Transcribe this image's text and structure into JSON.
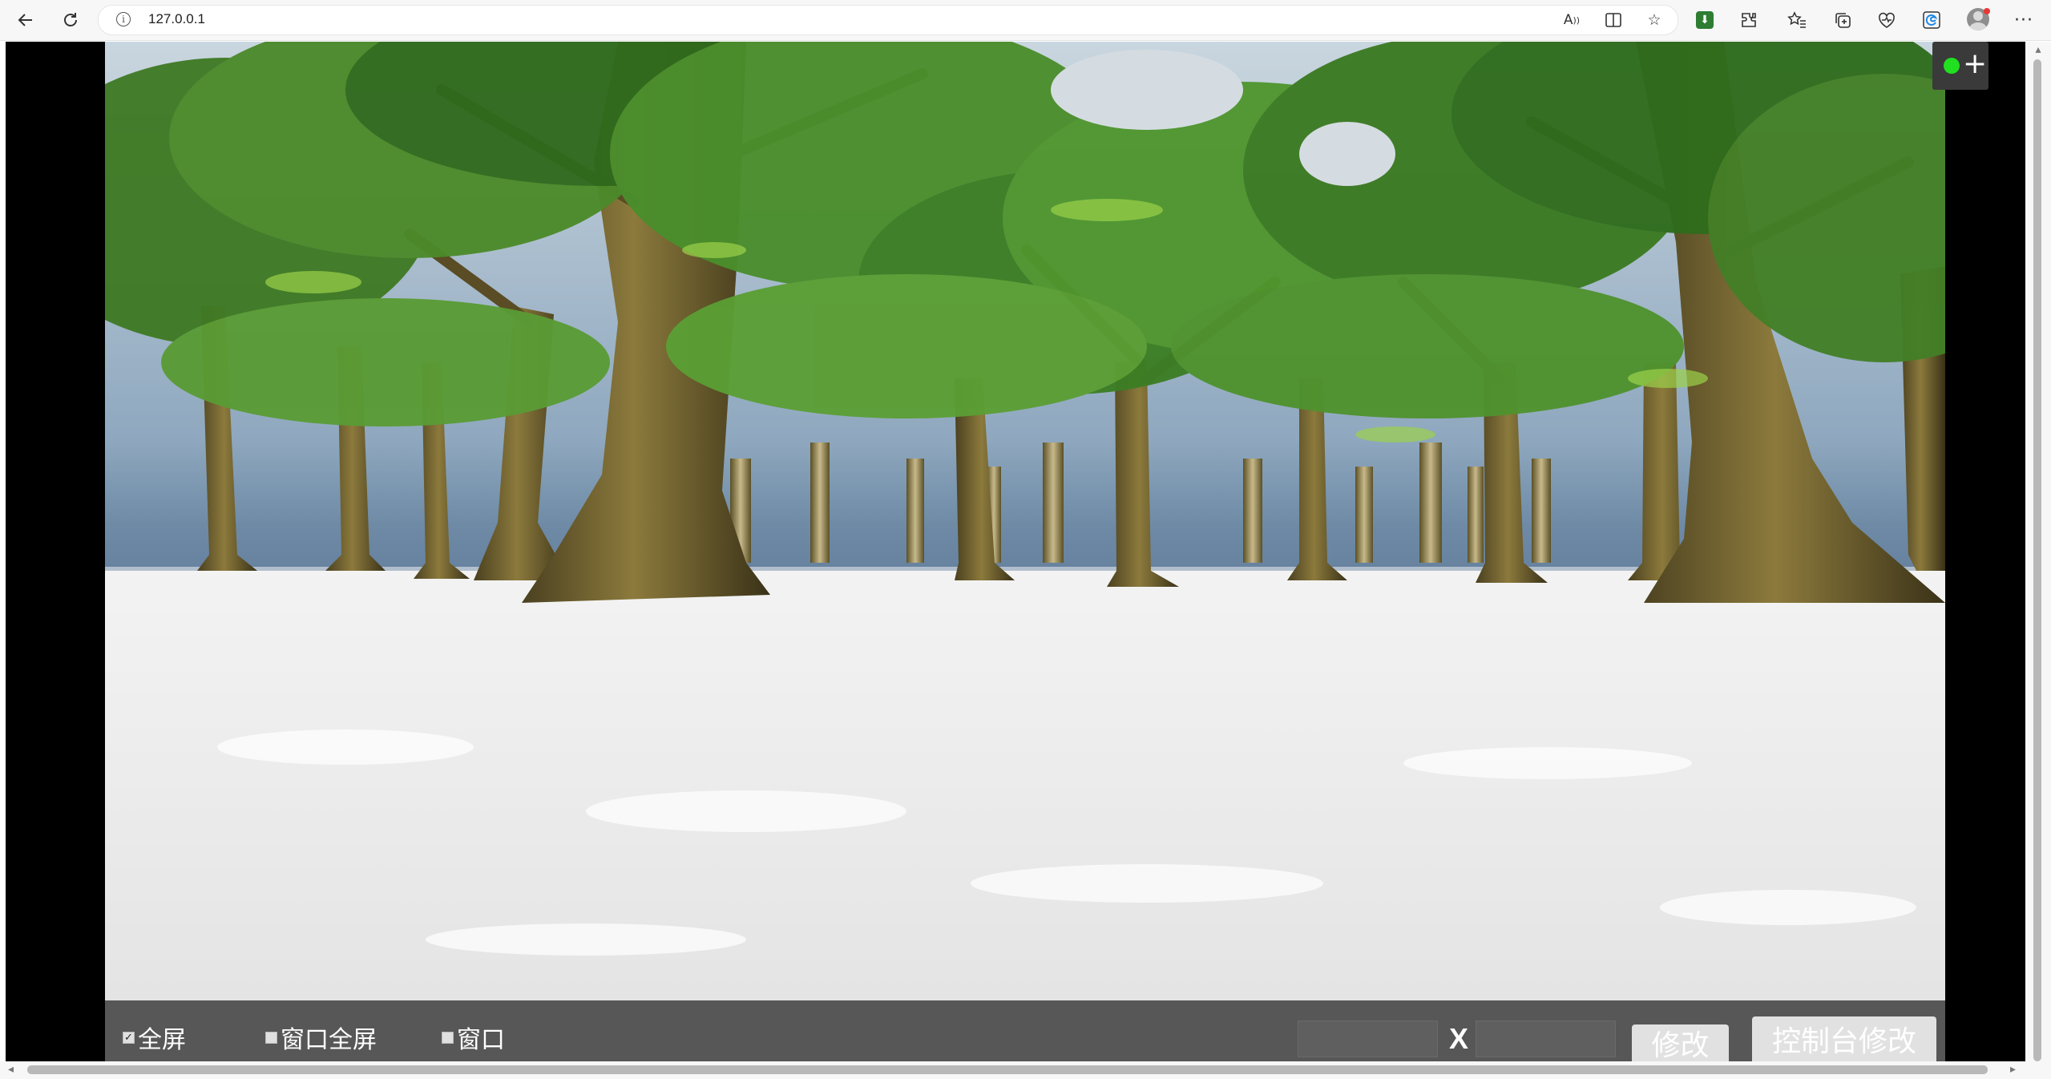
{
  "browser": {
    "url": "127.0.0.1",
    "read_aloud_text": "A",
    "icons": [
      "back-icon",
      "refresh-icon",
      "info-icon",
      "read-aloud-icon",
      "split-screen-icon",
      "favorite-star-icon",
      "download-icon",
      "extensions-icon",
      "favorites-icon",
      "collections-icon",
      "performance-icon",
      "edge-copilot-icon",
      "profile-avatar",
      "more-icon"
    ]
  },
  "controls": {
    "fullscreen_label": "全屏",
    "window_fullscreen_label": "窗口全屏",
    "window_label": "窗口",
    "fullscreen_checked": true,
    "window_fullscreen_checked": false,
    "window_checked": false,
    "width_value": "",
    "height_value": "",
    "x_separator": "X",
    "modify_label": "修改",
    "console_modify_label": "控制台修改"
  },
  "widget": {
    "status_color": "#20e020",
    "plus_symbol": "+"
  }
}
